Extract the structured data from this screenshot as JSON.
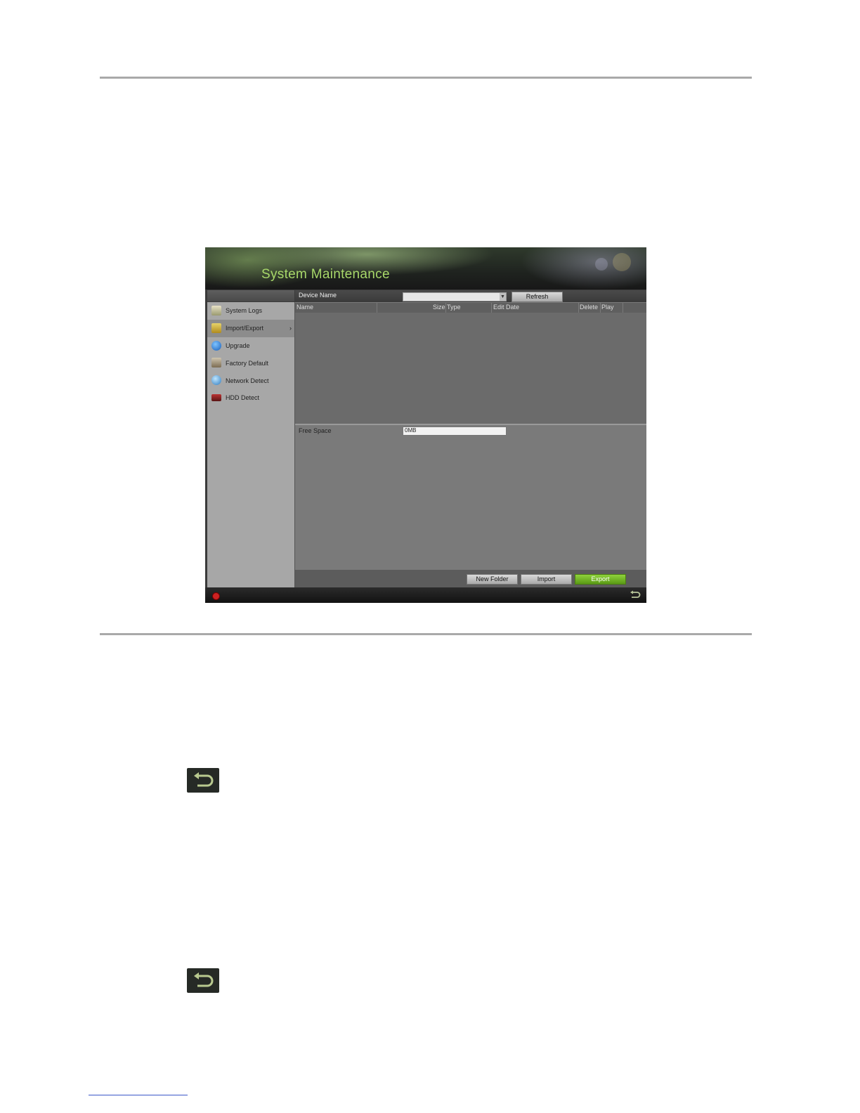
{
  "window": {
    "title": "System Maintenance"
  },
  "menu": {
    "items": [
      {
        "label": "System Logs",
        "icon": "log-icon",
        "active": false
      },
      {
        "label": "Import/Export",
        "icon": "folder-icon",
        "active": true
      },
      {
        "label": "Upgrade",
        "icon": "upgrade-icon",
        "active": false
      },
      {
        "label": "Factory Default",
        "icon": "factory-icon",
        "active": false
      },
      {
        "label": "Network Detect",
        "icon": "network-icon",
        "active": false
      },
      {
        "label": "HDD Detect",
        "icon": "hdd-icon",
        "active": false
      }
    ],
    "active_arrow": "›"
  },
  "toolbar": {
    "device_name_label": "Device Name",
    "device_value": "",
    "refresh_label": "Refresh"
  },
  "table": {
    "columns": [
      "Name",
      "Size",
      "Type",
      "Edit Date",
      "Delete",
      "Play"
    ],
    "rows": []
  },
  "storage": {
    "free_space_label": "Free Space",
    "free_space_value": "0MB"
  },
  "actions": {
    "new_folder": "New Folder",
    "import": "Import",
    "export": "Export"
  },
  "colors": {
    "title_green": "#a8d86a",
    "export_green": "#6fb022",
    "menu_bg": "#a7a7a7",
    "table_bg": "#6b6b6b"
  }
}
